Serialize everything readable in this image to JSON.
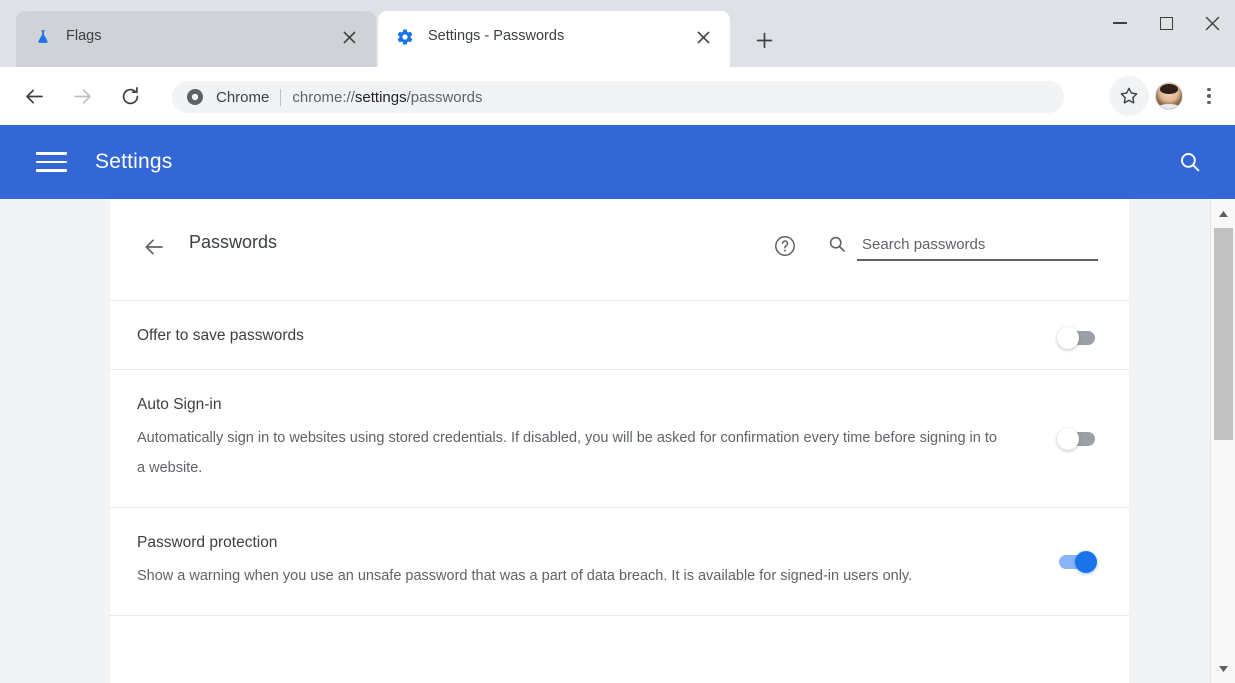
{
  "browser": {
    "tabs": [
      {
        "title": "Flags",
        "favicon": "flask-icon",
        "active": false
      },
      {
        "title": "Settings - Passwords",
        "favicon": "gear-icon",
        "active": true
      }
    ],
    "new_tab_label": "+",
    "window_controls": {
      "minimize": "minimize-icon",
      "maximize": "maximize-icon",
      "close": "close-icon"
    },
    "toolbar": {
      "back": "back-arrow-icon",
      "forward": "forward-arrow-icon",
      "reload": "reload-icon",
      "omnibox": {
        "security_icon": "chrome-logo-icon",
        "chip_label": "Chrome",
        "url_scheme": "chrome://",
        "url_strong": "settings",
        "url_tail": "/passwords"
      },
      "bookmark": "star-icon",
      "profile": "avatar",
      "menu": "three-dot-menu-icon"
    }
  },
  "settings_header": {
    "menu_icon": "hamburger-menu-icon",
    "title": "Settings",
    "search_icon": "search-icon"
  },
  "page": {
    "back_icon": "back-arrow-icon",
    "title": "Passwords",
    "help_icon": "help-circle-icon",
    "search": {
      "icon": "search-icon",
      "placeholder": "Search passwords",
      "value": ""
    },
    "rows": [
      {
        "title": "Offer to save passwords",
        "description": "",
        "toggle": "off"
      },
      {
        "title": "Auto Sign-in",
        "description": "Automatically sign in to websites using stored credentials. If disabled, you will be asked for confirmation every time before signing in to a website.",
        "toggle": "off"
      },
      {
        "title": "Password protection",
        "description": "Show a warning when you use an unsafe password that was a part of data breach. It is available for signed-in users only.",
        "toggle": "on"
      }
    ]
  },
  "scrollbar": {
    "up_arrow": "scroll-up-arrow-icon",
    "down_arrow": "scroll-down-arrow-icon"
  },
  "colors": {
    "settings_header_blue": "#3367d6",
    "toggle_on_track": "#8ab4f8",
    "toggle_on_knob": "#1a73e8",
    "toggle_off_track": "#9aa0a6",
    "page_background": "#f1f3f4",
    "card_background": "#ffffff"
  }
}
